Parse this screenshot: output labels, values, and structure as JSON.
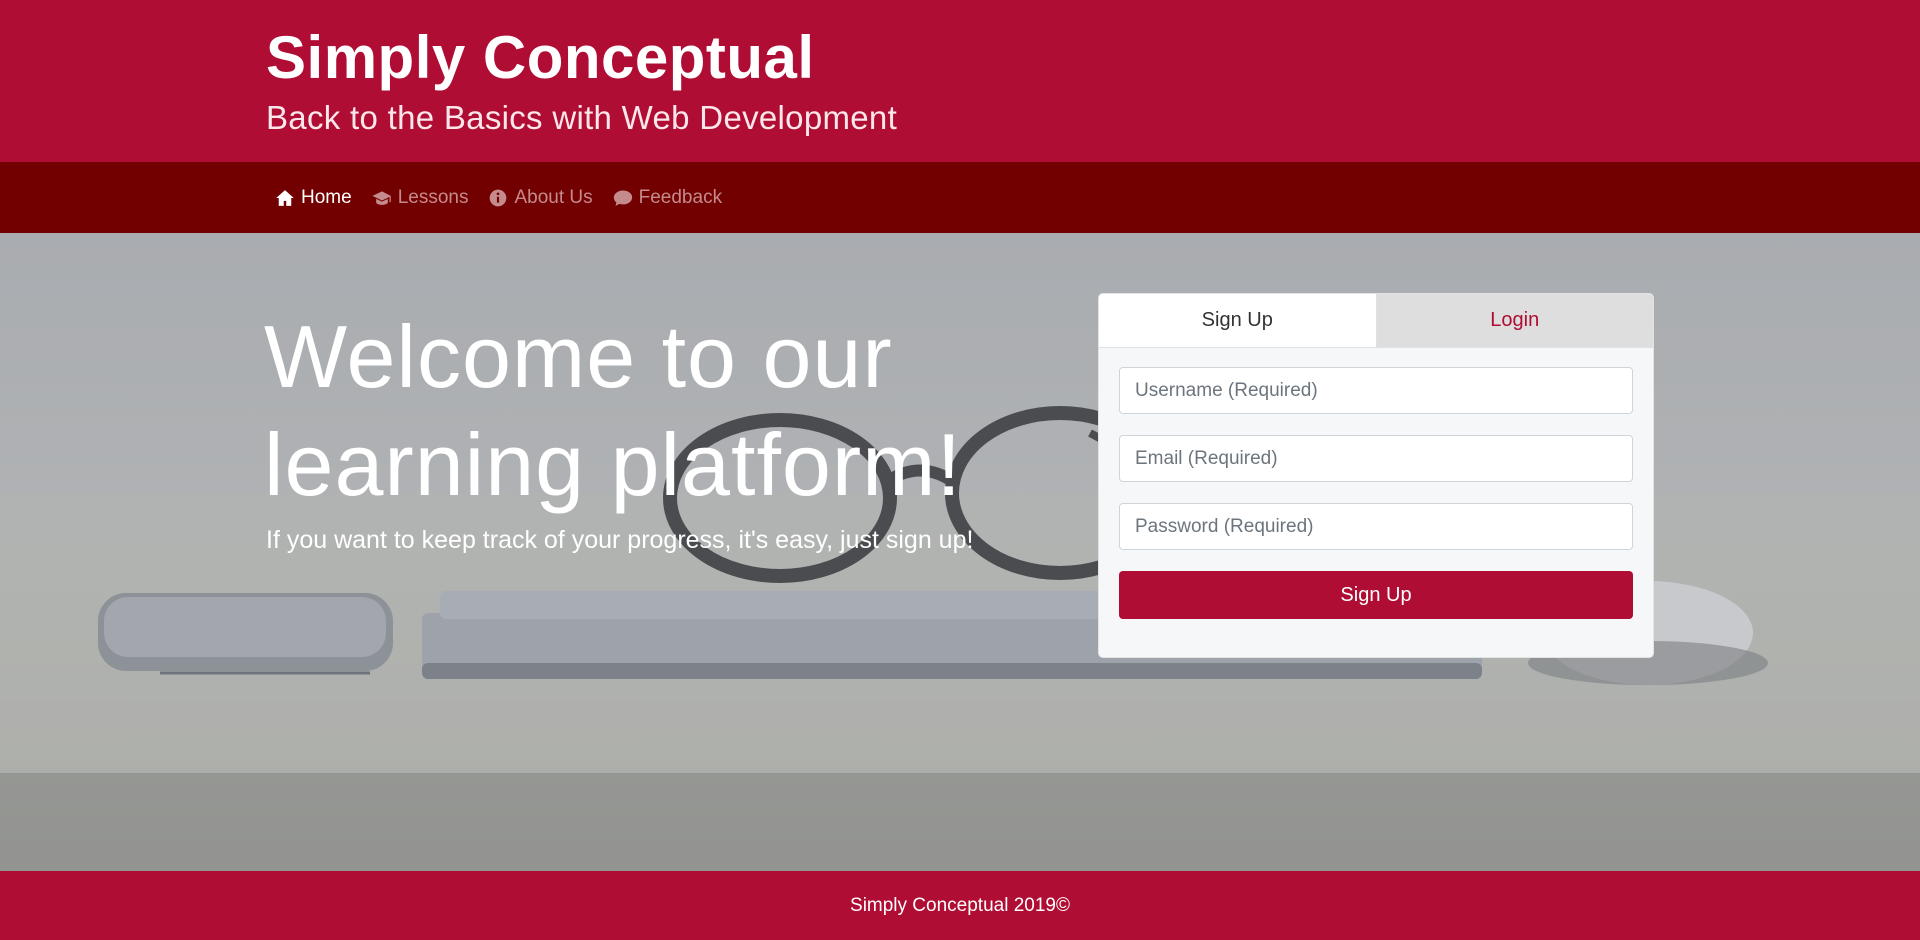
{
  "colors": {
    "brand": "#b00d35",
    "nav_background": "#730000",
    "nav_inactive_text": "#c58a8c",
    "white": "#ffffff"
  },
  "header": {
    "title": "Simply Conceptual",
    "subtitle": "Back to the Basics with Web Development"
  },
  "nav": {
    "items": [
      {
        "label": "Home",
        "icon": "home-icon",
        "active": true
      },
      {
        "label": "Lessons",
        "icon": "graduation-cap-icon",
        "active": false
      },
      {
        "label": "About Us",
        "icon": "info-circle-icon",
        "active": false
      },
      {
        "label": "Feedback",
        "icon": "comment-icon",
        "active": false
      }
    ]
  },
  "hero": {
    "heading": "Welcome to our learning platform!",
    "text": "If you want to keep track of your progress, it's easy, just sign up!"
  },
  "form": {
    "tabs": [
      {
        "label": "Sign Up",
        "active": true
      },
      {
        "label": "Login",
        "active": false
      }
    ],
    "fields": {
      "username": {
        "placeholder": "Username (Required)",
        "value": ""
      },
      "email": {
        "placeholder": "Email (Required)",
        "value": ""
      },
      "password": {
        "placeholder": "Password (Required)",
        "value": ""
      }
    },
    "submit_label": "Sign Up"
  },
  "footer": {
    "text": "Simply Conceptual 2019©"
  }
}
